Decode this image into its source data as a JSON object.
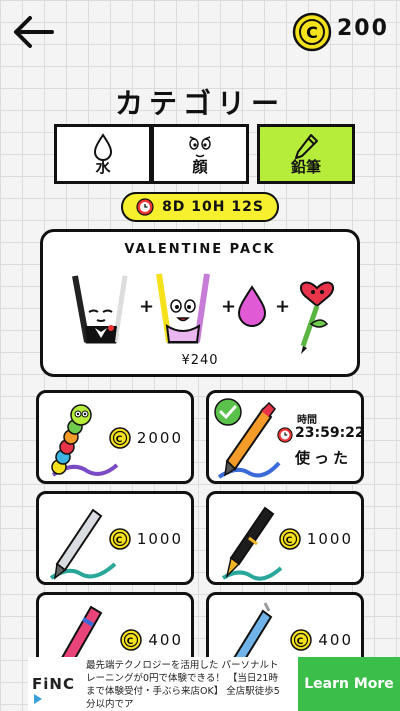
{
  "header": {
    "back_icon": "back-arrow-icon",
    "coin_icon": "coin-icon",
    "coin_count": "200"
  },
  "page_title": "カテゴリー",
  "tabs": [
    {
      "label": "水",
      "icon": "water-drop-icon",
      "active": false
    },
    {
      "label": "顔",
      "icon": "face-icon",
      "active": false
    },
    {
      "label": "鉛筆",
      "icon": "pencil-icon",
      "active": true
    }
  ],
  "timer": {
    "icon": "clock-icon",
    "text": "8D 10H 12S"
  },
  "pack": {
    "title": "VALENTINE PACK",
    "price": "¥240",
    "items": [
      "cup-tuxedo-icon",
      "cup-girl-icon",
      "pink-drop-icon",
      "heart-flower-icon"
    ]
  },
  "items": [
    {
      "pen": "caterpillar-pencil-icon",
      "price": "2000",
      "owned": false
    },
    {
      "pen": "orange-pen-icon",
      "owned": true,
      "timer_label": "時間",
      "timer_value": "23:59:22",
      "status": "使った"
    },
    {
      "pen": "silver-pen-icon",
      "price": "1000",
      "owned": false
    },
    {
      "pen": "fountain-pen-icon",
      "price": "1000",
      "owned": false
    },
    {
      "pen": "pink-pen-icon",
      "price": "400",
      "owned": false
    },
    {
      "pen": "blue-pen-icon",
      "price": "400",
      "owned": false
    }
  ],
  "ad": {
    "logo": "FiNC",
    "text": "最先端テクノロジーを活用した パーソナルトレーニングが0円で体験できる！ 【当日21時まで体験受付・手ぶら来店OK】 全店駅徒歩5分以内でア",
    "button": "Learn More"
  },
  "colors": {
    "accent_green": "#b6ec3a",
    "coin_yellow": "#f6e21c",
    "timer_yellow": "#f6f02e",
    "ad_green": "#3cbf4a"
  }
}
